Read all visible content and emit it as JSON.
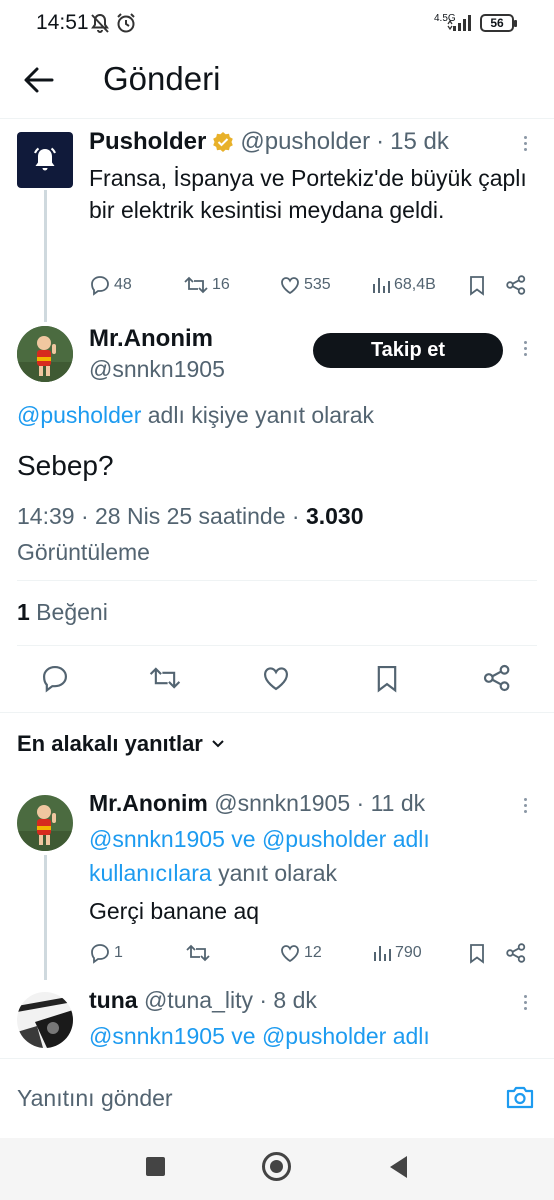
{
  "status_bar": {
    "time": "14:51",
    "network": "4.5G",
    "battery": "56"
  },
  "header": {
    "title": "Gönderi"
  },
  "parent_tweet": {
    "author": "Pusholder",
    "handle": "@pusholder",
    "time": "15 dk",
    "text": "Fransa, İspanya ve Portekiz'de büyük çaplı bir elektrik kesintisi meydana geldi.",
    "replies": "48",
    "retweets": "16",
    "likes": "535",
    "views": "68,4B"
  },
  "main_tweet": {
    "author": "Mr.Anonim",
    "handle": "@snnkn1905",
    "follow_label": "Takip et",
    "reply_to_mention": "@pusholder",
    "reply_to_suffix": " adlı kişiye yanıt olarak",
    "text": "Sebep?",
    "timestamp": "14:39 · 28 Nis 25 saatinde · ",
    "views_count": "3.030",
    "views_label": "Görüntüleme",
    "likes_count": "1",
    "likes_label": " Beğeni"
  },
  "replies_section": {
    "sort_label": "En alakalı yanıtlar"
  },
  "replies": [
    {
      "author": "Mr.Anonim",
      "handle": "@snnkn1905",
      "time": "11 dk",
      "reply_to_line1": "@snnkn1905 ve @pusholder adlı",
      "reply_to_line2_blue": "kullanıcılara",
      "reply_to_line2_rest": " yanıt olarak",
      "text": "Gerçi banane aq",
      "replies": "1",
      "likes": "12",
      "views": "790"
    },
    {
      "author": "tuna",
      "handle": "@tuna_lity",
      "time": "8 dk",
      "reply_to_line1": "@snnkn1905 ve @pusholder adlı"
    }
  ],
  "composer": {
    "placeholder": "Yanıtını gönder"
  },
  "colors": {
    "accent": "#1d9bf0",
    "text": "#0f1419",
    "muted": "#536471",
    "verified": "#e8b12a"
  }
}
